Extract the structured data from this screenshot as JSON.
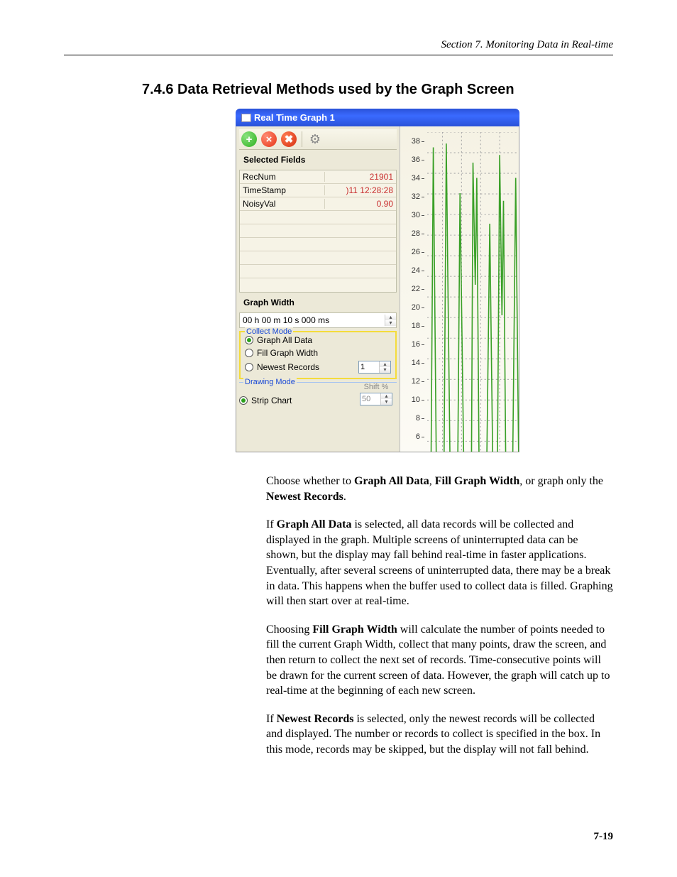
{
  "header": {
    "section_label": "Section 7.  Monitoring Data in Real-time"
  },
  "heading": "7.4.6  Data Retrieval Methods used by the Graph Screen",
  "window": {
    "title": "Real Time Graph 1",
    "toolbar": {
      "add": "+",
      "remove": "×",
      "remove_all": "✖"
    },
    "selected_fields_label": "Selected Fields",
    "fields": [
      {
        "name": "RecNum",
        "value": "21901"
      },
      {
        "name": "TimeStamp",
        "value": ")11 12:28:28"
      },
      {
        "name": "NoisyVal",
        "value": "0.90"
      },
      {
        "name": "",
        "value": ""
      },
      {
        "name": "",
        "value": ""
      },
      {
        "name": "",
        "value": ""
      },
      {
        "name": "",
        "value": ""
      },
      {
        "name": "",
        "value": ""
      },
      {
        "name": "",
        "value": ""
      }
    ],
    "graph_width_label": "Graph Width",
    "graph_width_value": "00 h 00 m 10 s 000 ms",
    "collect_mode": {
      "legend": "Collect Mode",
      "opt_all": "Graph All Data",
      "opt_fill": "Fill Graph Width",
      "opt_newest": "Newest Records",
      "newest_value": "1"
    },
    "drawing_mode": {
      "legend": "Drawing Mode",
      "opt_strip": "Strip Chart",
      "shift_label": "Shift %",
      "shift_value": "50"
    },
    "y_ticks": [
      "38",
      "36",
      "34",
      "32",
      "30",
      "28",
      "26",
      "24",
      "22",
      "20",
      "18",
      "16",
      "14",
      "12",
      "10",
      "8",
      "6"
    ]
  },
  "paragraphs": {
    "p1_pre": "Choose whether to ",
    "p1_b1": "Graph All Data",
    "p1_mid1": ", ",
    "p1_b2": "Fill Graph Width",
    "p1_mid2": ", or graph only the ",
    "p1_b3": "Newest Records",
    "p1_post": ".",
    "p2_pre": "If ",
    "p2_b": "Graph All Data",
    "p2_rest": " is selected, all data records will be collected and displayed in the graph.  Multiple screens of uninterrupted data can be shown, but the display may fall behind real-time in faster applications.  Eventually, after several screens of uninterrupted data, there may be a break in data.  This happens when the buffer used to collect data is filled.  Graphing will then start over at real-time.",
    "p3_pre": "Choosing ",
    "p3_b": "Fill Graph Width",
    "p3_rest": " will calculate the number of points needed to fill the current Graph Width, collect that many points, draw the screen, and then return to collect the next set of records.  Time-consecutive points will be drawn for the current screen of data.  However, the graph will catch up to real-time at the beginning of each new screen.",
    "p4_pre": "If ",
    "p4_b": "Newest Records",
    "p4_rest": " is selected, only the newest records will be collected and displayed.  The number or records to collect is specified in the box.  In this mode, records may be skipped, but the display will not fall behind."
  },
  "page_number": "7-19"
}
